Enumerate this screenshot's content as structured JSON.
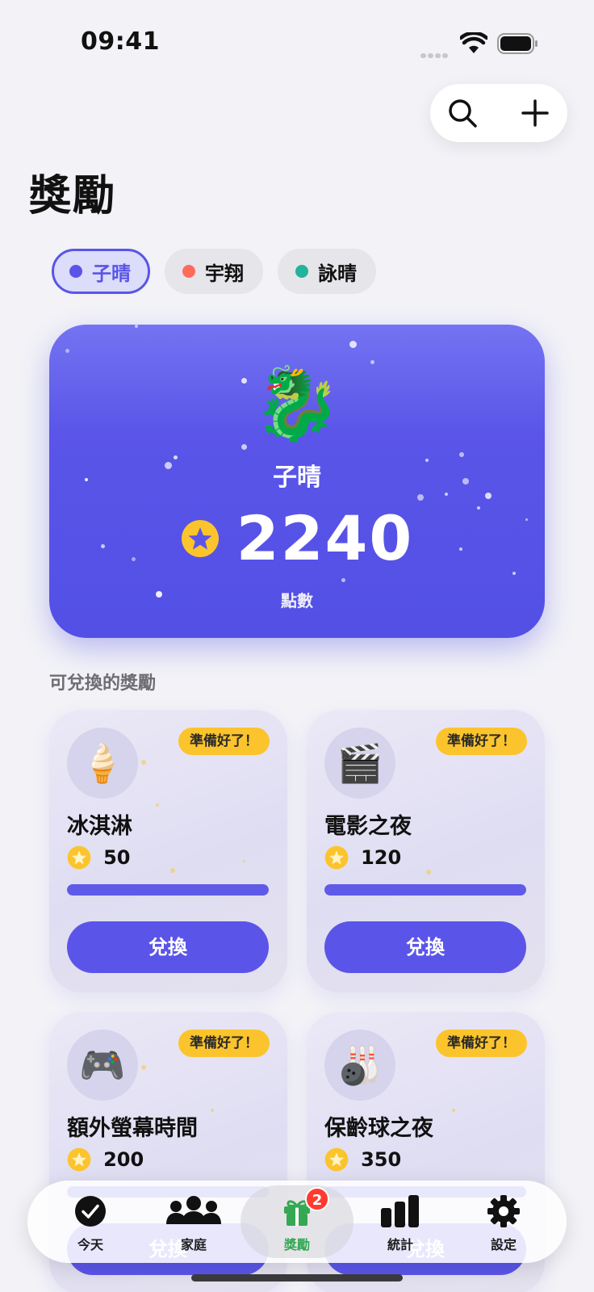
{
  "status_bar": {
    "time": "09:41"
  },
  "header": {
    "title": "獎勵",
    "search_icon": "search-icon",
    "add_icon": "plus-icon"
  },
  "kid_tabs": [
    {
      "name": "子晴",
      "color": "#5a55e6",
      "active": true
    },
    {
      "name": "宇翔",
      "color": "#ff6b5b",
      "active": false
    },
    {
      "name": "詠晴",
      "color": "#22b39a",
      "active": false
    }
  ],
  "hero": {
    "avatar": "🐉",
    "name": "子晴",
    "points": "2240",
    "points_label": "點數"
  },
  "section_title": "可兌換的獎勵",
  "rewards": [
    {
      "emoji": "🍦",
      "badge": "準備好了！",
      "name": "冰淇淋",
      "cost": "50",
      "progress": 1.0,
      "button": "兌換"
    },
    {
      "emoji": "🎬",
      "badge": "準備好了！",
      "name": "電影之夜",
      "cost": "120",
      "progress": 1.0,
      "button": "兌換"
    },
    {
      "emoji": "🎮",
      "badge": "準備好了！",
      "name": "額外螢幕時間",
      "cost": "200",
      "progress": 1.0,
      "button": "兌換"
    },
    {
      "emoji": "🎳",
      "badge": "準備好了！",
      "name": "保齡球之夜",
      "cost": "350",
      "progress": 1.0,
      "button": "兌換"
    }
  ],
  "tab_bar": {
    "items": [
      {
        "label": "今天",
        "icon": "checkmark-circle-icon"
      },
      {
        "label": "家庭",
        "icon": "people-icon"
      },
      {
        "label": "獎勵",
        "icon": "gift-icon",
        "badge": "2",
        "active": true
      },
      {
        "label": "統計",
        "icon": "bar-chart-icon"
      },
      {
        "label": "設定",
        "icon": "gear-icon"
      }
    ]
  },
  "colors": {
    "accent": "#5a55e8",
    "badge": "#fcc42c",
    "active_tab": "#34a853",
    "notification": "#ff3b30"
  }
}
